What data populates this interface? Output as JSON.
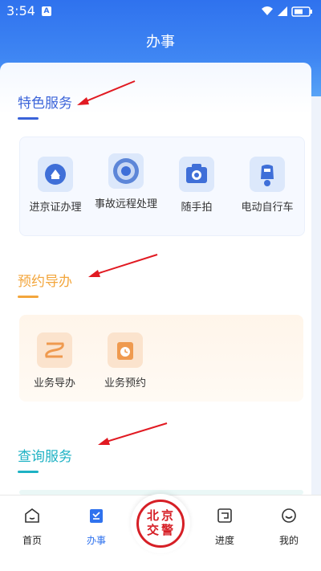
{
  "status": {
    "time": "3:54",
    "app_badge": "A"
  },
  "header": {
    "title": "办事"
  },
  "sections": [
    {
      "title": "特色服务",
      "items": [
        "进京证办理",
        "事故远程处理",
        "随手拍",
        "电动自行车"
      ]
    },
    {
      "title": "预约导办",
      "items": [
        "业务导办",
        "业务预约"
      ]
    },
    {
      "title": "查询服务",
      "items": []
    }
  ],
  "nav": {
    "home": "首页",
    "banshi": "办事",
    "progress": "进度",
    "mine": "我的",
    "seal_chars": [
      "北",
      "京",
      "交",
      "警"
    ]
  },
  "colors": {
    "primary": "#2f72ee",
    "sec1": "#3a63d9",
    "sec2": "#f3a63c",
    "sec3": "#1eb2c4",
    "arrow": "#e11a22"
  }
}
